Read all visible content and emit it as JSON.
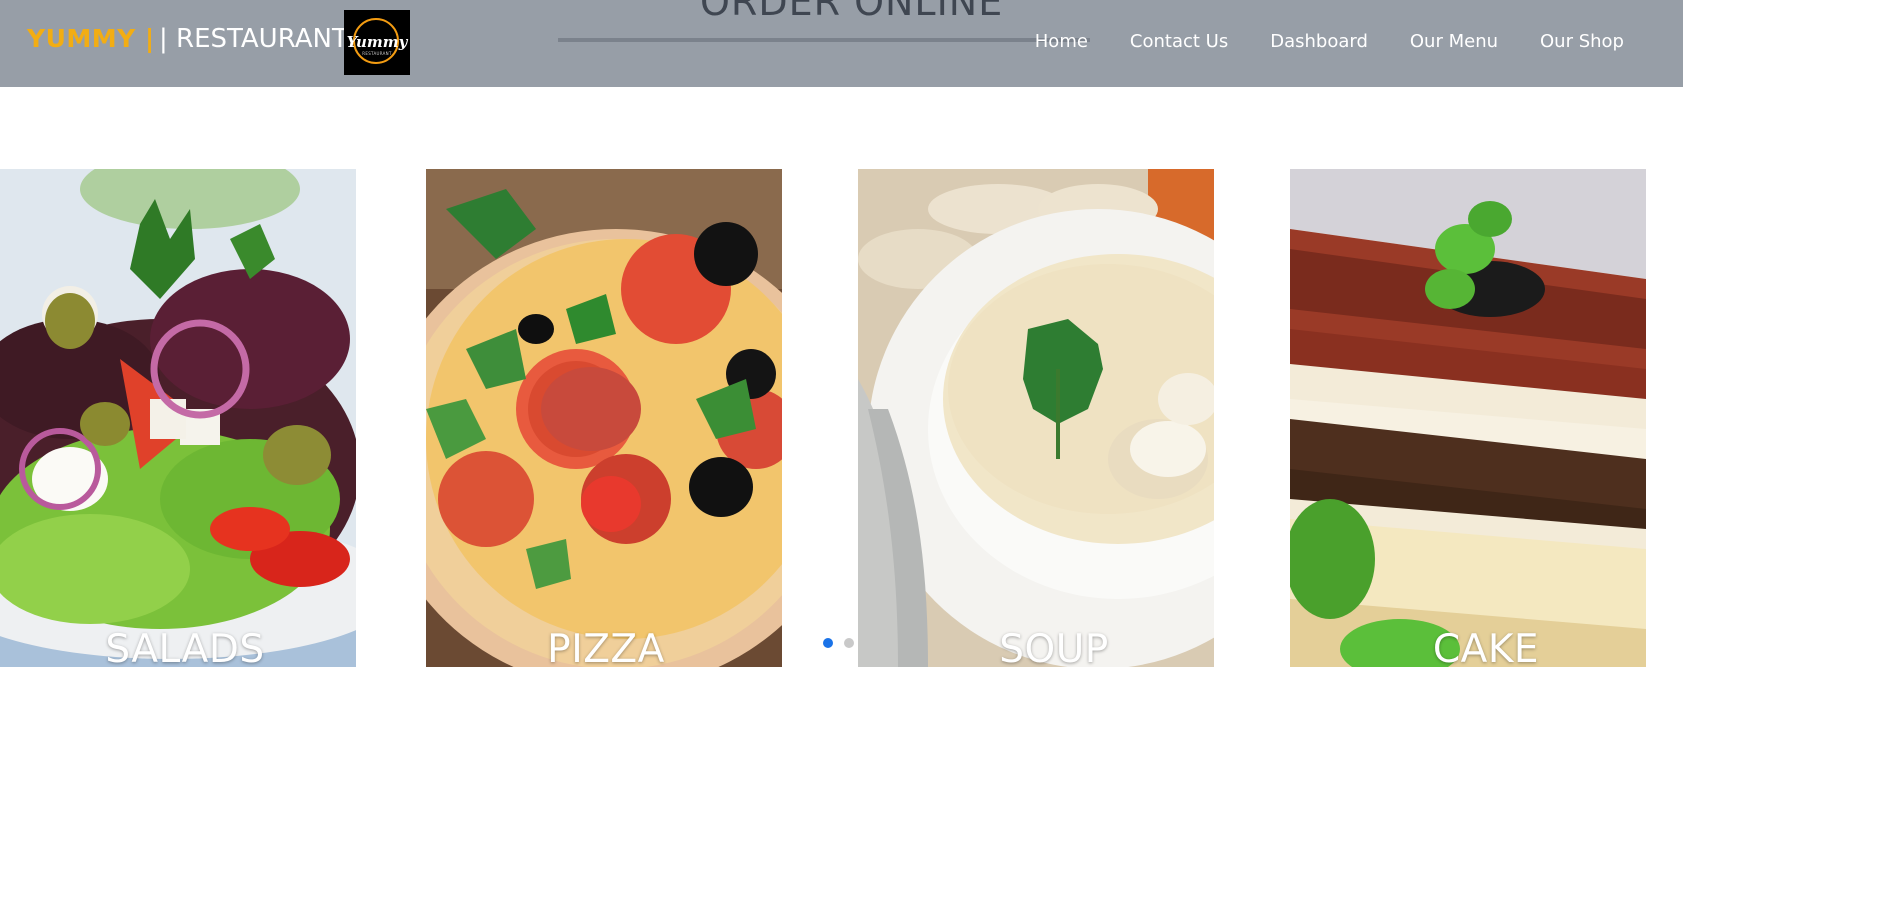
{
  "brand": {
    "yummy": "YUMMY |",
    "restaurant": "| RESTAURANT |",
    "logo_word": "Yummy",
    "logo_sub": "RESTAURANT"
  },
  "hero": {
    "heading": "ORDER ONLINE"
  },
  "nav": {
    "items": [
      "Home",
      "Contact Us",
      "Dashboard",
      "Our Menu",
      "Our Shop"
    ]
  },
  "cards": [
    {
      "label": "SALADS"
    },
    {
      "label": "PIZZA"
    },
    {
      "label": "SOUP"
    },
    {
      "label": "CAKE"
    }
  ],
  "carousel": {
    "active_index": 0,
    "dot_count": 2
  },
  "colors": {
    "navbar": "#979ea7",
    "brand_accent": "#f2ad13",
    "active_dot": "#1a73e8"
  }
}
